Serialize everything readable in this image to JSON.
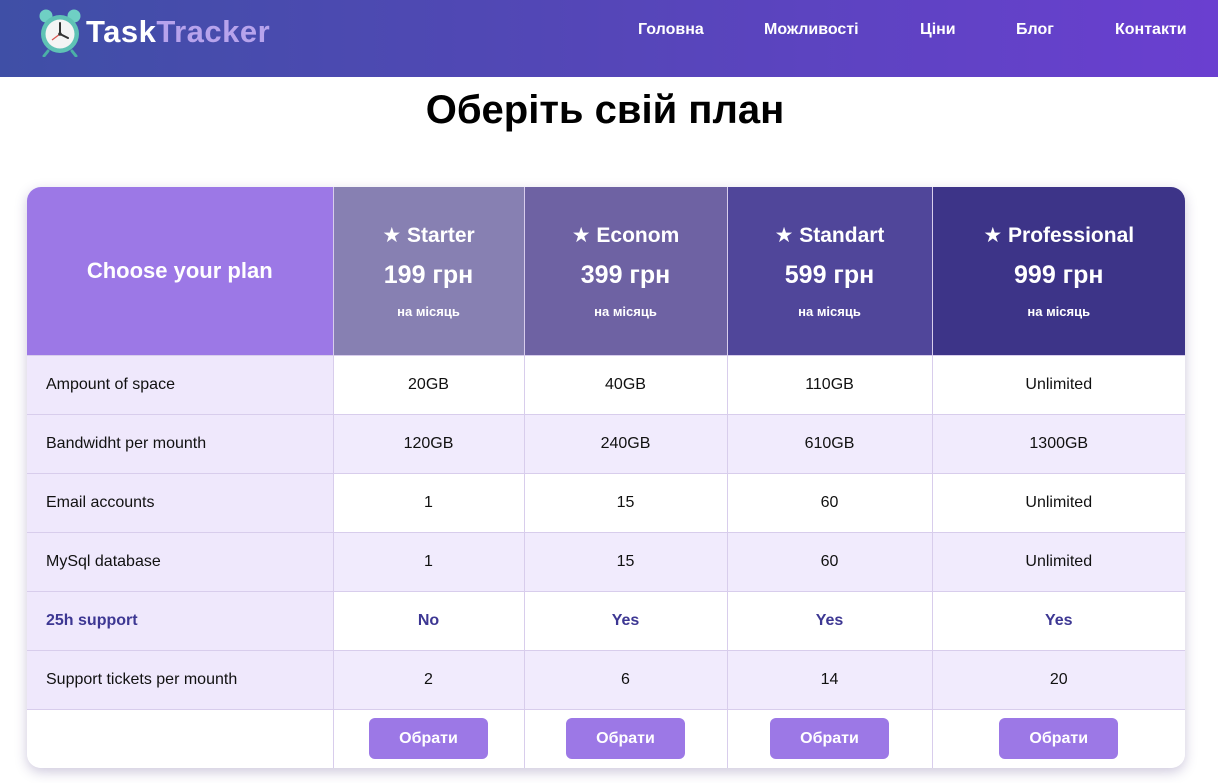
{
  "brand": {
    "name_part1": "Task",
    "name_part2": "Tracker",
    "logo_icon": "alarm-clock-icon"
  },
  "nav": [
    "Головна",
    "Можливості",
    "Ціни",
    "Блог",
    "Контакти"
  ],
  "page_title": "Оберіть свій план",
  "table": {
    "corner_label": "Choose your plan",
    "plans": [
      {
        "name": "★ Starter",
        "price": "199 грн",
        "period": "на місяць",
        "color": "#8780b2"
      },
      {
        "name": "★ Econom",
        "price": "399 грн",
        "period": "на місяць",
        "color": "#6e62a3"
      },
      {
        "name": "★ Standart",
        "price": "599 грн",
        "period": "на місяць",
        "color": "#50469a"
      },
      {
        "name": "★ Professional",
        "price": "999 грн",
        "period": "на місяць",
        "color": "#3d3488"
      }
    ],
    "rows": [
      {
        "label": "Ampount of space",
        "values": [
          "20GB",
          "40GB",
          "110GB",
          "Unlimited"
        ]
      },
      {
        "label": "Bandwidht per mounth",
        "values": [
          "120GB",
          "240GB",
          "610GB",
          "1300GB"
        ]
      },
      {
        "label": "Email accounts",
        "values": [
          "1",
          "15",
          "60",
          "Unlimited"
        ]
      },
      {
        "label": "MySql database",
        "values": [
          "1",
          "15",
          "60",
          "Unlimited"
        ]
      },
      {
        "label": "25h support",
        "values": [
          "No",
          "Yes",
          "Yes",
          "Yes"
        ]
      },
      {
        "label": "Support tickets per mounth",
        "values": [
          "2",
          "6",
          "14",
          "20"
        ]
      }
    ],
    "button_label": "Обрати"
  }
}
